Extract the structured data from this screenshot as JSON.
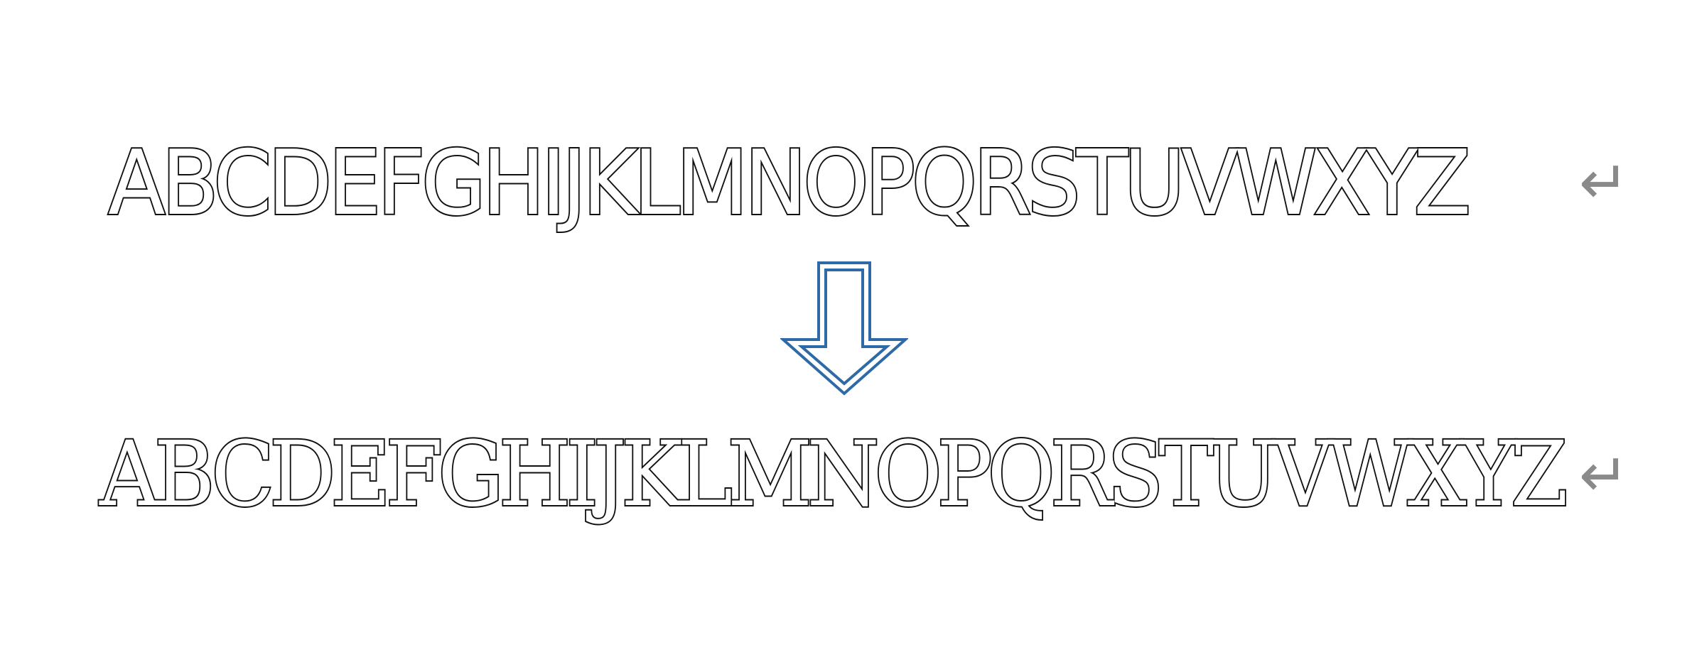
{
  "document": {
    "line1_text": "ABCDEFGHIJKLMNOPQRSTUVWXYZ",
    "line2_text": "ABCDEFGHIJKLMNOPQRSTUVWXYZ",
    "paragraph_mark": "↵"
  },
  "arrow": {
    "icon": "down-arrow-icon",
    "color": "#2e6aa6"
  },
  "colors": {
    "text_outline": "#111111",
    "paragraph_mark": "#8a8a8a",
    "background": "#ffffff"
  }
}
